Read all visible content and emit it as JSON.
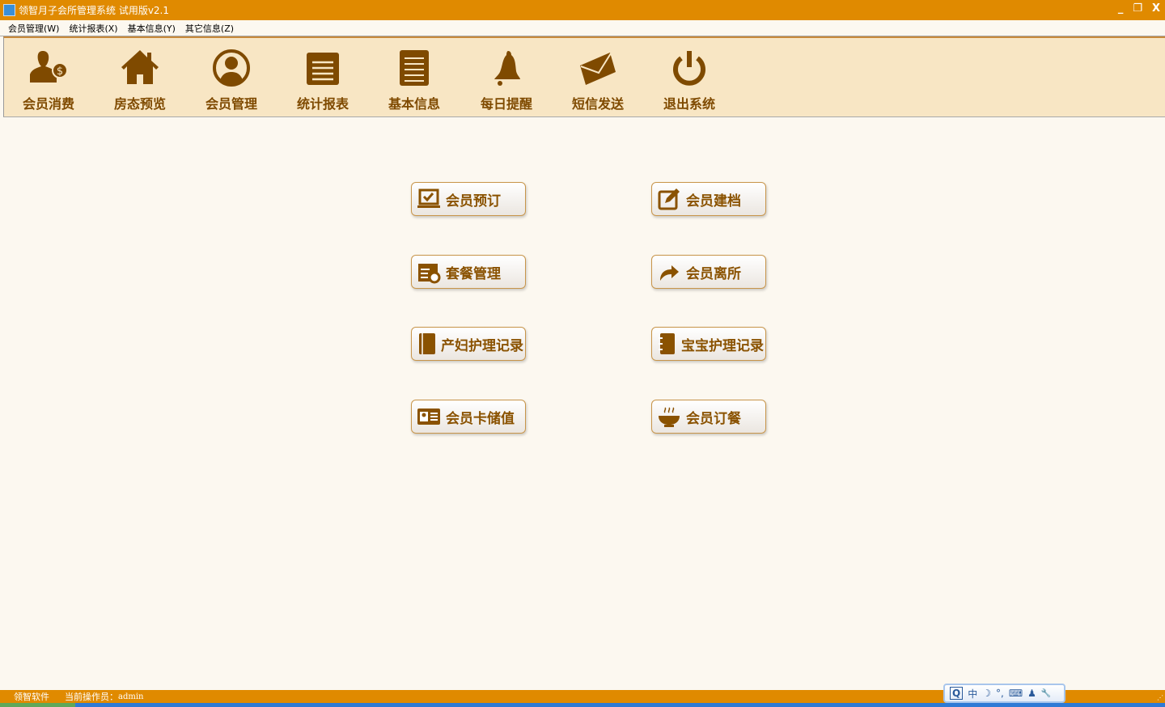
{
  "window": {
    "title": "领智月子会所管理系统 试用版v2.1",
    "minimize": "_",
    "restore": "❐",
    "close": "X"
  },
  "menu": [
    "会员管理(W)",
    "统计报表(X)",
    "基本信息(Y)",
    "其它信息(Z)"
  ],
  "toolbar": [
    {
      "label": "会员消费",
      "icon": "member-payment-icon"
    },
    {
      "label": "房态预览",
      "icon": "house-icon"
    },
    {
      "label": "会员管理",
      "icon": "user-circle-icon"
    },
    {
      "label": "统计报表",
      "icon": "notepad-icon"
    },
    {
      "label": "基本信息",
      "icon": "document-icon"
    },
    {
      "label": "每日提醒",
      "icon": "bell-icon"
    },
    {
      "label": "短信发送",
      "icon": "envelope-icon"
    },
    {
      "label": "退出系统",
      "icon": "power-icon"
    }
  ],
  "buttons": [
    {
      "label": "会员预订",
      "icon": "laptop-check-icon"
    },
    {
      "label": "会员建档",
      "icon": "edit-icon"
    },
    {
      "label": "套餐管理",
      "icon": "calendar-gear-icon"
    },
    {
      "label": "会员离所",
      "icon": "share-arrow-icon"
    },
    {
      "label": "产妇护理记录",
      "icon": "book-icon"
    },
    {
      "label": "宝宝护理记录",
      "icon": "notebook-icon"
    },
    {
      "label": "会员卡储值",
      "icon": "id-card-icon"
    },
    {
      "label": "会员订餐",
      "icon": "bowl-icon"
    }
  ],
  "status": {
    "company": "领智软件",
    "operator_label": "当前操作员：",
    "operator": "admin"
  },
  "ime": [
    "Q",
    "中",
    "☽",
    "°,",
    "⌨",
    "♟",
    "🔧"
  ],
  "colors": {
    "accent": "#e08a00",
    "brown": "#7f4a00",
    "toolbar_bg": "#f8e6c4"
  }
}
